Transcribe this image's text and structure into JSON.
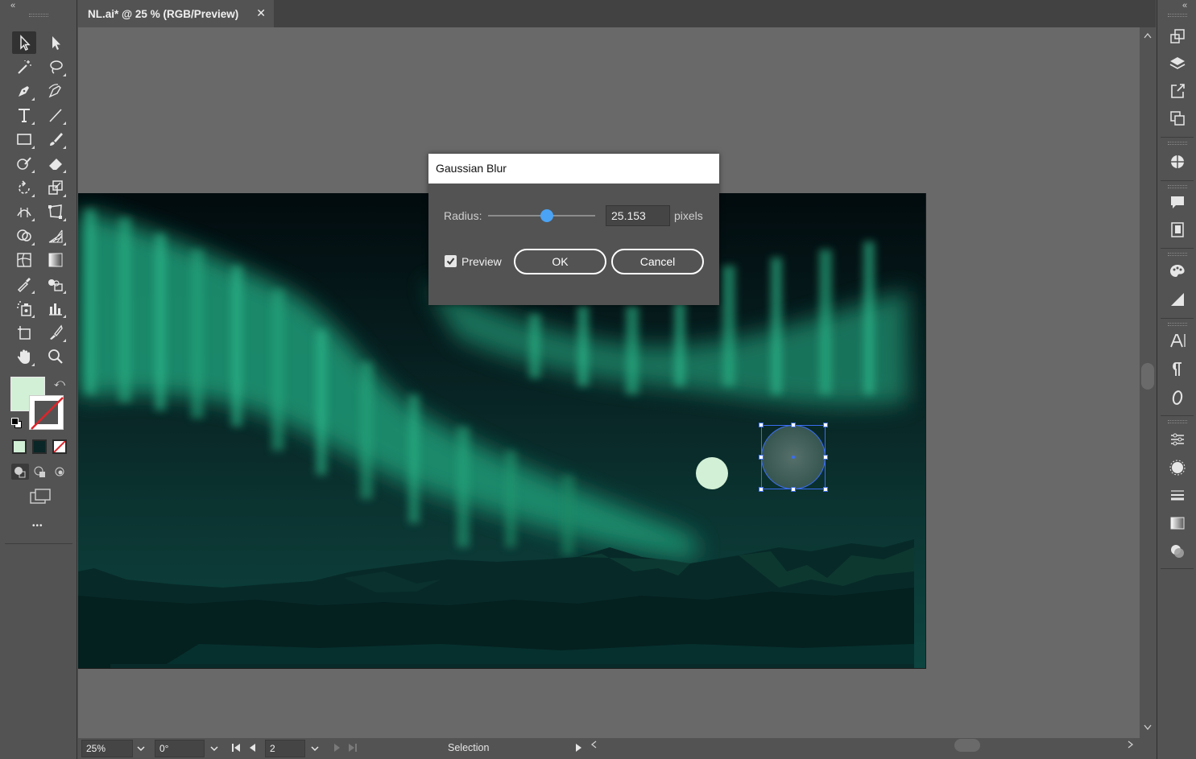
{
  "document_tab": {
    "title": "NL.ai* @ 25 % (RGB/Preview)",
    "close_glyph": "✕"
  },
  "toolbar": {
    "collapse_glyph": "«",
    "more_glyph": "•••",
    "tools": [
      "selection-tool",
      "direct-selection-tool",
      "magic-wand-tool",
      "lasso-tool",
      "pen-tool",
      "curvature-tool",
      "type-tool",
      "line-segment-tool",
      "rectangle-tool",
      "paintbrush-tool",
      "shaper-tool",
      "eraser-tool",
      "rotate-tool",
      "scale-tool",
      "width-tool",
      "free-transform-tool",
      "shape-builder-tool",
      "perspective-grid-tool",
      "mesh-tool",
      "gradient-tool",
      "eyedropper-tool",
      "blend-tool",
      "symbol-sprayer-tool",
      "column-graph-tool",
      "artboard-tool",
      "slice-tool",
      "hand-tool",
      "zoom-tool"
    ],
    "fill_color": "#d2f0d6",
    "stroke": "none"
  },
  "statusbar": {
    "zoom": "25%",
    "rotation": "0°",
    "artboard_number": "2",
    "status_text": "Selection"
  },
  "dialog": {
    "title": "Gaussian Blur",
    "radius_label": "Radius:",
    "radius_value": "25.153",
    "radius_unit": "pixels",
    "preview_label": "Preview",
    "preview_checked": true,
    "ok_label": "OK",
    "cancel_label": "Cancel",
    "slider_accent": "#4aa3f5"
  },
  "right_panel": {
    "collapse_glyph": "«",
    "icons": [
      "artboards-icon",
      "layers-icon",
      "export-icon",
      "arrange-icon",
      "color-guide-icon",
      "comments-icon",
      "libraries-icon",
      "color-palette-icon",
      "gradient-panel-icon",
      "character-icon",
      "paragraph-icon",
      "opentype-icon",
      "properties-icon",
      "appearance-icon",
      "stroke-icon",
      "gradient-icon",
      "transparency-icon"
    ]
  },
  "colors": {
    "ui_bg": "#535353",
    "canvas_bg": "#696969",
    "selection_blue": "#3a6df0",
    "moon": "#d2f0d6"
  }
}
